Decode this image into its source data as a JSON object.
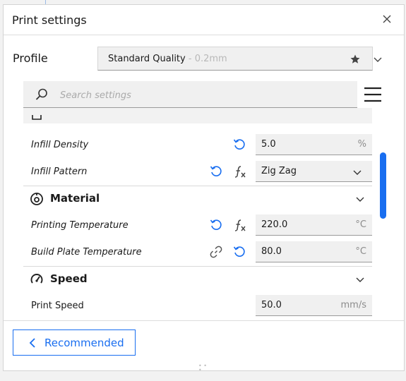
{
  "window": {
    "title": "Print settings"
  },
  "profile": {
    "label": "Profile",
    "name": "Standard Quality",
    "sub": " - 0.2mm"
  },
  "search": {
    "placeholder": "Search settings"
  },
  "infill": {
    "density": {
      "label": "Infill Density",
      "value": "5.0",
      "unit": "%"
    },
    "pattern": {
      "label": "Infill Pattern",
      "value": "Zig Zag"
    }
  },
  "material": {
    "title": "Material",
    "print_temp": {
      "label": "Printing Temperature",
      "value": "220.0",
      "unit": "°C"
    },
    "bed_temp": {
      "label": "Build Plate Temperature",
      "value": "80.0",
      "unit": "°C"
    }
  },
  "speed": {
    "title": "Speed",
    "print_speed": {
      "label": "Print Speed",
      "value": "50.0",
      "unit": "mm/s"
    }
  },
  "footer": {
    "recommended_label": "Recommended"
  },
  "colors": {
    "accent": "#196ef0",
    "field_bg": "#f0f0f0",
    "text": "#1a1a1a",
    "muted": "#8c8c8c"
  },
  "icons": [
    "close-icon",
    "star-icon",
    "chevron-down-icon",
    "search-icon",
    "menu-icon",
    "reset-icon",
    "function-icon",
    "link-icon",
    "material-icon",
    "speed-icon",
    "chevron-left-icon"
  ]
}
